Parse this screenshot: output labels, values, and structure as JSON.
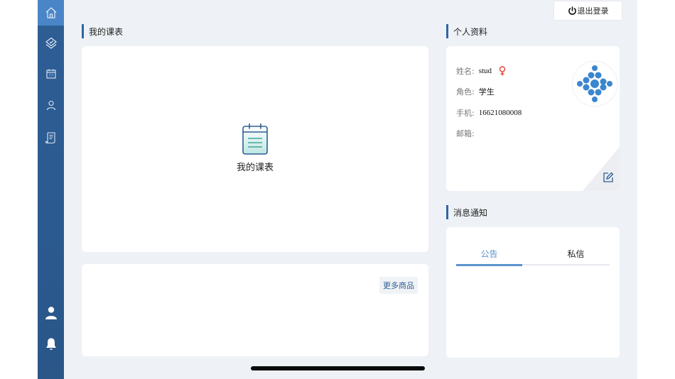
{
  "header": {
    "logout_label": "退出登录"
  },
  "sidebar": {
    "items": [
      {
        "icon": "home-icon",
        "active": true
      },
      {
        "icon": "course-stack-icon",
        "active": false
      },
      {
        "icon": "calendar-icon",
        "active": false
      },
      {
        "icon": "profile-icon",
        "active": false
      },
      {
        "icon": "document-icon",
        "active": false
      }
    ],
    "bottom_items": [
      {
        "icon": "user-icon"
      },
      {
        "icon": "bell-icon"
      }
    ]
  },
  "schedule": {
    "section_title": "我的课表",
    "placeholder_label": "我的课表"
  },
  "products": {
    "more_label": "更多商品"
  },
  "profile": {
    "section_title": "个人资料",
    "fields": [
      {
        "label": "姓名:",
        "value": "stud",
        "gender_icon": "female-icon"
      },
      {
        "label": "角色:",
        "value": "学生"
      },
      {
        "label": "手机:",
        "value": "16621080008"
      },
      {
        "label": "邮箱:",
        "value": ""
      }
    ]
  },
  "messages": {
    "section_title": "消息通知",
    "tabs": [
      {
        "label": "公告",
        "active": true
      },
      {
        "label": "私信",
        "active": false
      }
    ]
  },
  "colors": {
    "sidebar": "#2e5e95",
    "sidebar_active": "#4a86c7",
    "accent": "#2f65a3",
    "tab_active": "#5b93cc",
    "gender": "#e0473a"
  }
}
